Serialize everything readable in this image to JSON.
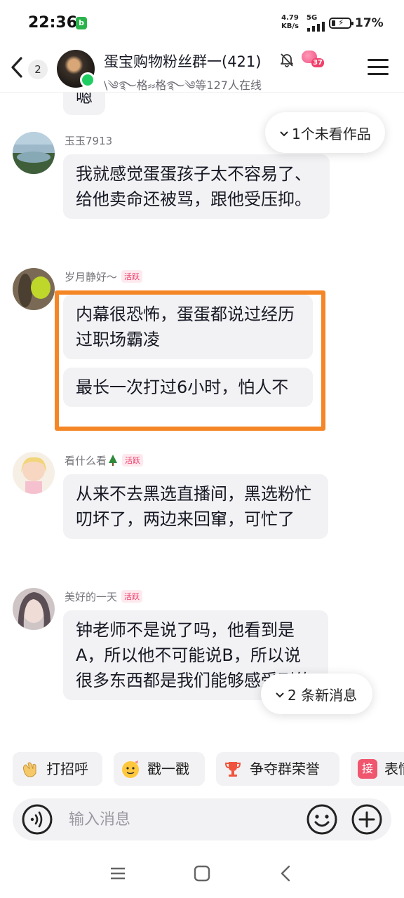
{
  "status_bar": {
    "time": "22:36",
    "app_icon": "b",
    "speed_value": "4.79",
    "speed_unit": "KB/s",
    "network": "5G",
    "battery_level": 0.17,
    "battery": "17%"
  },
  "header": {
    "unread_count": "2",
    "title": "蛋宝购物粉丝群一(421)",
    "level": "37",
    "online_text": "\\༄࿐格⸗⸗格࿐༄等127人在线"
  },
  "messages": [
    {
      "sender": "",
      "text": "嗯",
      "active": false
    },
    {
      "sender": "玉玉7913",
      "text": "我就感觉蛋蛋孩子太不容易了、给他卖命还被骂，跟他受压抑。",
      "active": false
    },
    {
      "sender": "岁月静好～",
      "text": "内幕很恐怖，蛋蛋都说过经历过职场霸凌",
      "text2": "最长一次打过6小时，怕人不",
      "active": true
    },
    {
      "sender": "看什么看",
      "text": "从来不去黑选直播间，黑选粉忙叨坏了，两边来回窜，可忙了",
      "active": true
    },
    {
      "sender": "美好的一天",
      "text": "钟老师不是说了吗，他看到是A，所以他不可能说B，所以说很多东西都是我们能够感受到的",
      "active": true
    }
  ],
  "active_tag": "活跃",
  "unseen_works": "1个未看作品",
  "new_messages": "2 条新消息",
  "quick_actions": [
    {
      "label": "打招呼",
      "icon": "wave-hand-icon"
    },
    {
      "label": "戳一戳",
      "icon": "poke-face-icon"
    },
    {
      "label": "争夺群荣誉",
      "icon": "trophy-icon"
    },
    {
      "label": "表情",
      "icon": "sticker-icon",
      "icon_text": "接"
    }
  ],
  "input": {
    "placeholder": "输入消息"
  },
  "colors": {
    "accent": "#f58626",
    "tag": "#ee3a68",
    "online": "#1fce62"
  }
}
